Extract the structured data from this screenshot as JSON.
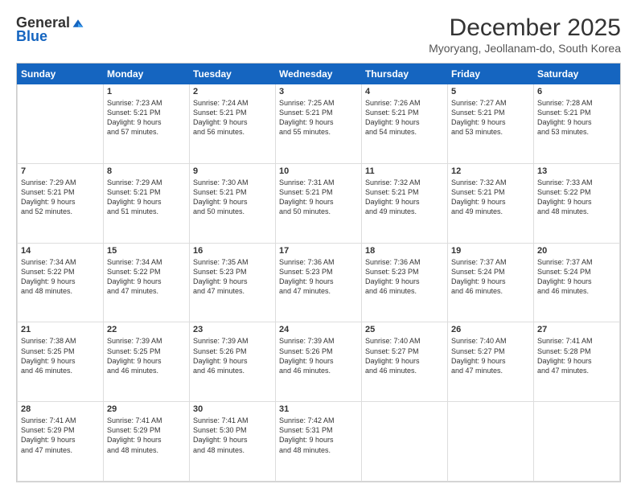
{
  "logo": {
    "general": "General",
    "blue": "Blue"
  },
  "title": "December 2025",
  "location": "Myoryang, Jeollanam-do, South Korea",
  "days_of_week": [
    "Sunday",
    "Monday",
    "Tuesday",
    "Wednesday",
    "Thursday",
    "Friday",
    "Saturday"
  ],
  "weeks": [
    [
      {
        "day": "",
        "info": ""
      },
      {
        "day": "1",
        "info": "Sunrise: 7:23 AM\nSunset: 5:21 PM\nDaylight: 9 hours\nand 57 minutes."
      },
      {
        "day": "2",
        "info": "Sunrise: 7:24 AM\nSunset: 5:21 PM\nDaylight: 9 hours\nand 56 minutes."
      },
      {
        "day": "3",
        "info": "Sunrise: 7:25 AM\nSunset: 5:21 PM\nDaylight: 9 hours\nand 55 minutes."
      },
      {
        "day": "4",
        "info": "Sunrise: 7:26 AM\nSunset: 5:21 PM\nDaylight: 9 hours\nand 54 minutes."
      },
      {
        "day": "5",
        "info": "Sunrise: 7:27 AM\nSunset: 5:21 PM\nDaylight: 9 hours\nand 53 minutes."
      },
      {
        "day": "6",
        "info": "Sunrise: 7:28 AM\nSunset: 5:21 PM\nDaylight: 9 hours\nand 53 minutes."
      }
    ],
    [
      {
        "day": "7",
        "info": "Sunrise: 7:29 AM\nSunset: 5:21 PM\nDaylight: 9 hours\nand 52 minutes."
      },
      {
        "day": "8",
        "info": "Sunrise: 7:29 AM\nSunset: 5:21 PM\nDaylight: 9 hours\nand 51 minutes."
      },
      {
        "day": "9",
        "info": "Sunrise: 7:30 AM\nSunset: 5:21 PM\nDaylight: 9 hours\nand 50 minutes."
      },
      {
        "day": "10",
        "info": "Sunrise: 7:31 AM\nSunset: 5:21 PM\nDaylight: 9 hours\nand 50 minutes."
      },
      {
        "day": "11",
        "info": "Sunrise: 7:32 AM\nSunset: 5:21 PM\nDaylight: 9 hours\nand 49 minutes."
      },
      {
        "day": "12",
        "info": "Sunrise: 7:32 AM\nSunset: 5:21 PM\nDaylight: 9 hours\nand 49 minutes."
      },
      {
        "day": "13",
        "info": "Sunrise: 7:33 AM\nSunset: 5:22 PM\nDaylight: 9 hours\nand 48 minutes."
      }
    ],
    [
      {
        "day": "14",
        "info": "Sunrise: 7:34 AM\nSunset: 5:22 PM\nDaylight: 9 hours\nand 48 minutes."
      },
      {
        "day": "15",
        "info": "Sunrise: 7:34 AM\nSunset: 5:22 PM\nDaylight: 9 hours\nand 47 minutes."
      },
      {
        "day": "16",
        "info": "Sunrise: 7:35 AM\nSunset: 5:23 PM\nDaylight: 9 hours\nand 47 minutes."
      },
      {
        "day": "17",
        "info": "Sunrise: 7:36 AM\nSunset: 5:23 PM\nDaylight: 9 hours\nand 47 minutes."
      },
      {
        "day": "18",
        "info": "Sunrise: 7:36 AM\nSunset: 5:23 PM\nDaylight: 9 hours\nand 46 minutes."
      },
      {
        "day": "19",
        "info": "Sunrise: 7:37 AM\nSunset: 5:24 PM\nDaylight: 9 hours\nand 46 minutes."
      },
      {
        "day": "20",
        "info": "Sunrise: 7:37 AM\nSunset: 5:24 PM\nDaylight: 9 hours\nand 46 minutes."
      }
    ],
    [
      {
        "day": "21",
        "info": "Sunrise: 7:38 AM\nSunset: 5:25 PM\nDaylight: 9 hours\nand 46 minutes."
      },
      {
        "day": "22",
        "info": "Sunrise: 7:39 AM\nSunset: 5:25 PM\nDaylight: 9 hours\nand 46 minutes."
      },
      {
        "day": "23",
        "info": "Sunrise: 7:39 AM\nSunset: 5:26 PM\nDaylight: 9 hours\nand 46 minutes."
      },
      {
        "day": "24",
        "info": "Sunrise: 7:39 AM\nSunset: 5:26 PM\nDaylight: 9 hours\nand 46 minutes."
      },
      {
        "day": "25",
        "info": "Sunrise: 7:40 AM\nSunset: 5:27 PM\nDaylight: 9 hours\nand 46 minutes."
      },
      {
        "day": "26",
        "info": "Sunrise: 7:40 AM\nSunset: 5:27 PM\nDaylight: 9 hours\nand 47 minutes."
      },
      {
        "day": "27",
        "info": "Sunrise: 7:41 AM\nSunset: 5:28 PM\nDaylight: 9 hours\nand 47 minutes."
      }
    ],
    [
      {
        "day": "28",
        "info": "Sunrise: 7:41 AM\nSunset: 5:29 PM\nDaylight: 9 hours\nand 47 minutes."
      },
      {
        "day": "29",
        "info": "Sunrise: 7:41 AM\nSunset: 5:29 PM\nDaylight: 9 hours\nand 48 minutes."
      },
      {
        "day": "30",
        "info": "Sunrise: 7:41 AM\nSunset: 5:30 PM\nDaylight: 9 hours\nand 48 minutes."
      },
      {
        "day": "31",
        "info": "Sunrise: 7:42 AM\nSunset: 5:31 PM\nDaylight: 9 hours\nand 48 minutes."
      },
      {
        "day": "",
        "info": ""
      },
      {
        "day": "",
        "info": ""
      },
      {
        "day": "",
        "info": ""
      }
    ]
  ]
}
